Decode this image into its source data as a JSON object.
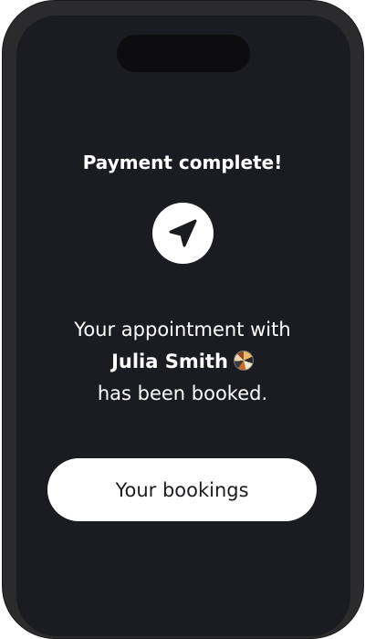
{
  "confirmation": {
    "title": "Payment complete!",
    "icon": "navigation-arrow-icon",
    "message_line1": "Your appointment with",
    "provider_name": "Julia Smith",
    "provider_avatar": "avatar",
    "message_line3": "has been booked."
  },
  "actions": {
    "bookings_label": "Your bookings"
  },
  "colors": {
    "screen_background": "#1b1c21",
    "frame": "#2b2b2d",
    "text": "#ffffff",
    "button_background": "#ffffff",
    "button_text": "#1b1c21"
  }
}
